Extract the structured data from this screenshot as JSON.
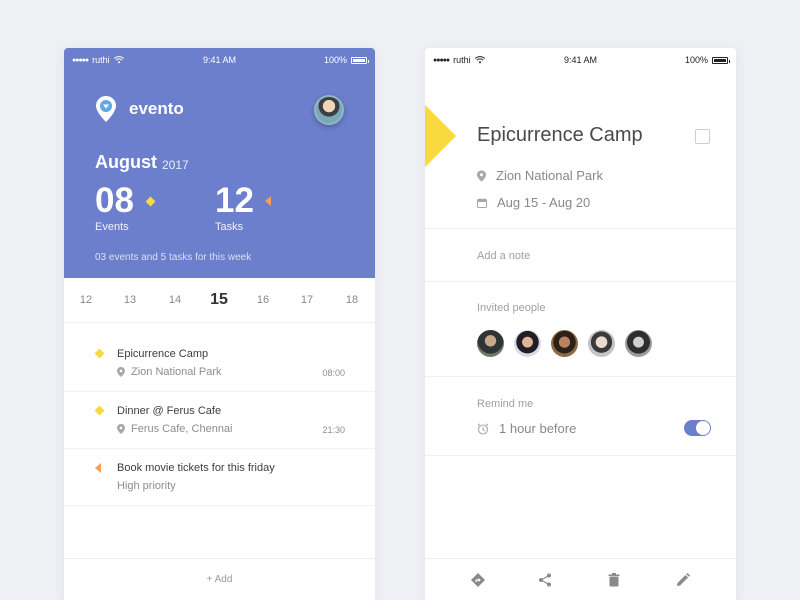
{
  "colors": {
    "accent": "#6b7fcc",
    "event_marker": "#f8da3e",
    "task_marker": "#f5a050",
    "background": "#eff0f4"
  },
  "left_screen": {
    "status_bar": {
      "carrier": "ruthi",
      "time": "9:41 AM",
      "battery": "100%"
    },
    "app": {
      "name": "evento",
      "logo_icon": "map-pin-icon"
    },
    "header": {
      "month": "August",
      "year": "2017",
      "events_count": "08",
      "events_label": "Events",
      "tasks_count": "12",
      "tasks_label": "Tasks",
      "week_summary": "03 events and 5 tasks for this week"
    },
    "dates": [
      "12",
      "13",
      "14",
      "15",
      "16",
      "17",
      "18"
    ],
    "selected_date": "15",
    "items": [
      {
        "type": "event",
        "title": "Epicurrence Camp",
        "subtitle": "Zion National Park",
        "time": "08:00"
      },
      {
        "type": "event",
        "title": "Dinner @ Ferus Cafe",
        "subtitle": "Ferus Cafe, Chennai",
        "time": "21:30"
      },
      {
        "type": "task",
        "title": "Book movie tickets for this friday",
        "subtitle": "High priority",
        "time": ""
      }
    ],
    "add_label": "+ Add"
  },
  "right_screen": {
    "status_bar": {
      "carrier": "ruthi",
      "time": "9:41 AM",
      "battery": "100%"
    },
    "event": {
      "title": "Epicurrence Camp",
      "location": "Zion National Park",
      "dates": "Aug 15 - Aug 20"
    },
    "note_placeholder": "Add a note",
    "invited_label": "Invited people",
    "invited_count": 5,
    "remind_label": "Remind me",
    "remind_value": "1 hour before",
    "remind_enabled": true,
    "toolbar": [
      "directions-icon",
      "share-icon",
      "delete-icon",
      "edit-icon"
    ]
  }
}
